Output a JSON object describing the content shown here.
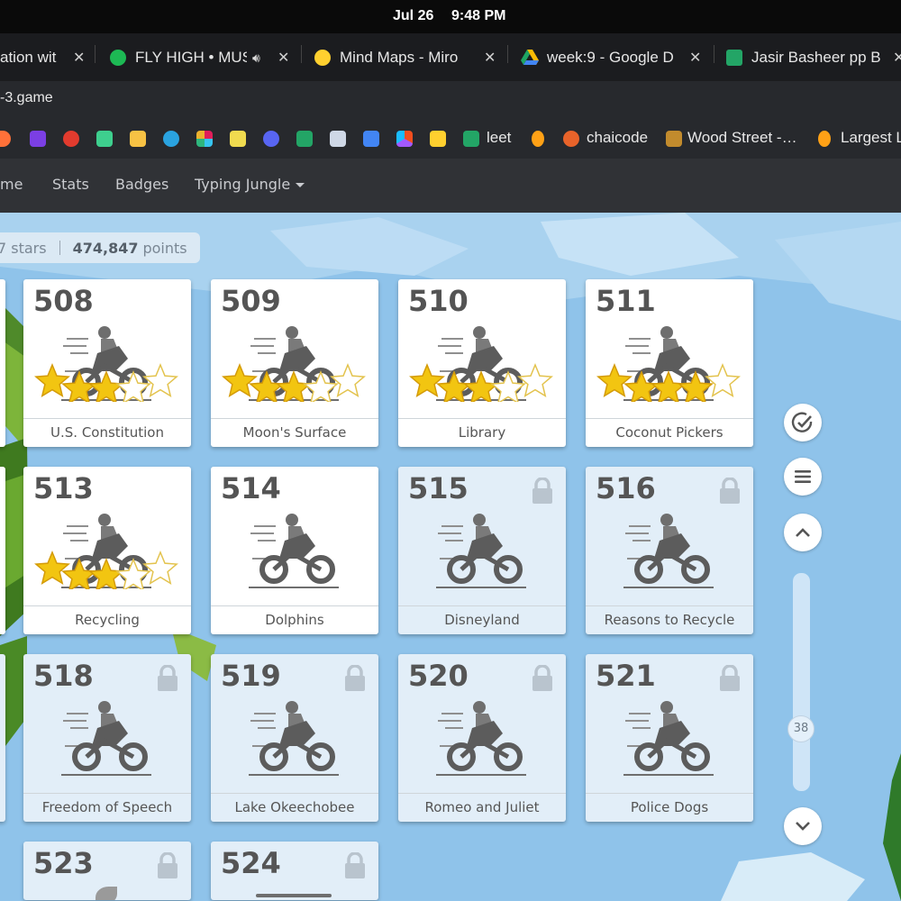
{
  "os_bar": {
    "date": "Jul 26",
    "time": "9:48 PM"
  },
  "tabs": [
    {
      "title": "ation wit",
      "icon": "partial-tab-icon"
    },
    {
      "title": "FLY HIGH • MUS",
      "icon": "spotify-icon",
      "color": "#1db954"
    },
    {
      "title": "Mind Maps - Miro",
      "icon": "miro-icon",
      "color": "#ffd02f"
    },
    {
      "title": "week:9 - Google D",
      "icon": "google-drive-icon"
    },
    {
      "title": "Jasir Basheer pp B",
      "icon": "google-sheets-icon",
      "color": "#23a566"
    }
  ],
  "address": {
    "text": "-3.game"
  },
  "bookmarks": [
    {
      "label": "leet"
    },
    {
      "label": "chaicode"
    },
    {
      "label": "Wood Street -…"
    },
    {
      "label": "Largest L"
    }
  ],
  "nav": {
    "items": [
      "me",
      "Stats",
      "Badges",
      "Typing Jungle"
    ]
  },
  "stats": {
    "stars": "7 stars",
    "points_num": "474,847",
    "points_label": "points"
  },
  "levels": [
    {
      "num": "508",
      "title": "U.S. Constitution",
      "locked": false,
      "stars": 3
    },
    {
      "num": "509",
      "title": "Moon's Surface",
      "locked": false,
      "stars": 3
    },
    {
      "num": "510",
      "title": "Library",
      "locked": false,
      "stars": 3
    },
    {
      "num": "511",
      "title": "Coconut Pickers",
      "locked": false,
      "stars": 4
    },
    {
      "num": "513",
      "title": "Recycling",
      "locked": false,
      "stars": 3
    },
    {
      "num": "514",
      "title": "Dolphins",
      "locked": false,
      "stars": 0
    },
    {
      "num": "515",
      "title": "Disneyland",
      "locked": true,
      "stars": 0
    },
    {
      "num": "516",
      "title": "Reasons to Recycle",
      "locked": true,
      "stars": 0
    },
    {
      "num": "518",
      "title": "Freedom of Speech",
      "locked": true,
      "stars": 0
    },
    {
      "num": "519",
      "title": "Lake Okeechobee",
      "locked": true,
      "stars": 0
    },
    {
      "num": "520",
      "title": "Romeo and Juliet",
      "locked": true,
      "stars": 0
    },
    {
      "num": "521",
      "title": "Police Dogs",
      "locked": true,
      "stars": 0
    },
    {
      "num": "523",
      "title": "",
      "locked": true,
      "stars": 0
    },
    {
      "num": "524",
      "title": "",
      "locked": true,
      "stars": 0
    }
  ],
  "scroll": {
    "value": "38"
  },
  "colors": {
    "star": "#f2c511",
    "sky": "#8fc3ea",
    "locked_card": "#e2eef8",
    "nav_bg": "#303236"
  }
}
